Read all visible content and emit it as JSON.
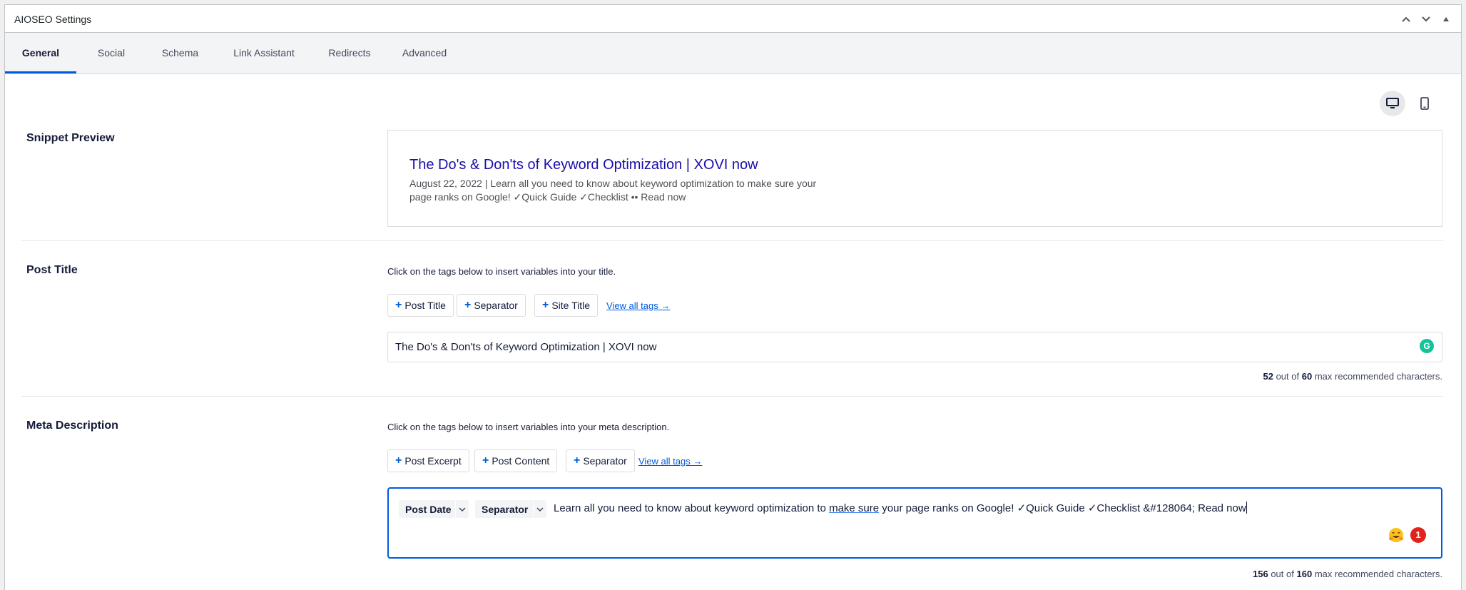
{
  "panel": {
    "title": "AIOSEO Settings",
    "controls": [
      "chevron-up-icon",
      "chevron-down-icon",
      "triangle-up-icon"
    ]
  },
  "tabs": [
    {
      "label": "General",
      "active": true
    },
    {
      "label": "Social",
      "active": false
    },
    {
      "label": "Schema",
      "active": false
    },
    {
      "label": "Link Assistant",
      "active": false
    },
    {
      "label": "Redirects",
      "active": false
    },
    {
      "label": "Advanced",
      "active": false
    }
  ],
  "device_toggle": {
    "selected": "desktop",
    "options": [
      "desktop-icon",
      "mobile-icon"
    ]
  },
  "snippet_preview": {
    "label": "Snippet Preview",
    "title": "The Do's & Don'ts of Keyword Optimization | XOVI now",
    "description": "August 22, 2022 | Learn all you need to know about keyword optimization to make sure your page ranks on Google! ✓Quick Guide ✓Checklist •• Read now"
  },
  "post_title": {
    "label": "Post Title",
    "hint": "Click on the tags below to insert variables into your title.",
    "tags": [
      "Post Title",
      "Separator",
      "Site Title"
    ],
    "view_all": "View all tags →",
    "value": "The Do's & Don'ts of Keyword Optimization | XOVI now",
    "count": "52",
    "max": "60",
    "counter_pre": "out of",
    "counter_post": "max recommended characters."
  },
  "meta_description": {
    "label": "Meta Description",
    "hint": "Click on the tags below to insert variables into your meta description.",
    "tags": [
      "Post Excerpt",
      "Post Content",
      "Separator"
    ],
    "view_all": "View all tags →",
    "chips": [
      "Post Date",
      "Separator"
    ],
    "text_pre": "Learn all you need to know about keyword optimization to ",
    "text_underlined": "make sure",
    "text_post": " your page ranks on Google! ✓Quick Guide ✓Checklist  &#128064; Read now",
    "badge": "1",
    "count": "156",
    "max": "160",
    "counter_pre": "out of",
    "counter_post": "max recommended characters."
  },
  "colors": {
    "accent": "#005ae0",
    "serp_title": "#1a0dab",
    "grammarly": "#15c39a",
    "badge": "#e2231a"
  }
}
